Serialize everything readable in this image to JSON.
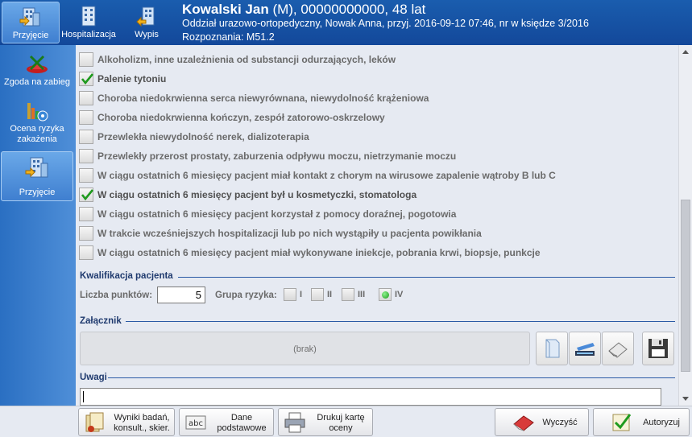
{
  "header": {
    "nav": [
      {
        "label": "Przyjęcie",
        "icon": "building-icon",
        "active": true
      },
      {
        "label": "Hospitalizacja",
        "icon": "building-icon",
        "active": false
      },
      {
        "label": "Wypis",
        "icon": "building-exit-icon",
        "active": false
      }
    ],
    "patient_name": "Kowalski Jan",
    "patient_rest": " (M), 00000000000, 48 lat",
    "line2": "Oddział urazowo-ortopedyczny, Nowak Anna, przyj. 2016-09-12 07:46, nr w księdze 3/2016",
    "line3": "Rozpoznania: M51.2"
  },
  "sidebar": {
    "items": [
      {
        "label": "Zgoda na zabieg",
        "icon": "consent-icon"
      },
      {
        "label": "Ocena ryzyka zakażenia",
        "icon": "risk-chart-icon"
      },
      {
        "label": "Przyjęcie",
        "icon": "building-icon",
        "active": true
      }
    ]
  },
  "checklist": [
    {
      "label": "Alkoholizm, inne uzależnienia od substancji odurzających, leków",
      "checked": false
    },
    {
      "label": "Palenie tytoniu",
      "checked": true
    },
    {
      "label": "Choroba niedokrwienna serca niewyrównana, niewydolność krążeniowa",
      "checked": false
    },
    {
      "label": "Choroba niedokrwienna kończyn, zespół zatorowo-oskrzelowy",
      "checked": false
    },
    {
      "label": "Przewlekła niewydolność nerek, dializoterapia",
      "checked": false
    },
    {
      "label": "Przewlekły przerost prostaty, zaburzenia odpływu moczu, nietrzymanie moczu",
      "checked": false
    },
    {
      "label": "W ciągu ostatnich 6 miesięcy pacjent miał kontakt z chorym na wirusowe zapalenie wątroby B lub C",
      "checked": false
    },
    {
      "label": "W ciągu ostatnich 6 miesięcy pacjent był u kosmetyczki, stomatologa",
      "checked": true
    },
    {
      "label": "W ciągu ostatnich 6 miesięcy pacjent korzystał z pomocy doraźnej, pogotowia",
      "checked": false
    },
    {
      "label": "W trakcie wcześniejszych hospitalizacji lub po nich wystąpiły u pacjenta powikłania",
      "checked": false
    },
    {
      "label": "W ciągu ostatnich 6 miesięcy pacjent miał wykonywane iniekcje, pobrania krwi, biopsje, punkcje",
      "checked": false
    }
  ],
  "qualification": {
    "title": "Kwalifikacja pacjenta",
    "points_label": "Liczba punktów:",
    "points_value": "5",
    "group_label": "Grupa ryzyka:",
    "groups": [
      "I",
      "II",
      "III",
      "IV"
    ],
    "selected_group": "IV"
  },
  "attachment": {
    "title": "Załącznik",
    "empty_text": "(brak)",
    "buttons": [
      "open-file-icon",
      "scanner-icon",
      "eraser-icon",
      "floppy-disk-icon"
    ]
  },
  "remarks": {
    "title": "Uwagi",
    "value": ""
  },
  "bottom": {
    "buttons": [
      {
        "line1": "Wyniki badań,",
        "line2": "konsult., skier.",
        "icon": "documents-icon"
      },
      {
        "line1": "Dane",
        "line2": "podstawowe",
        "icon": "abc-icon"
      },
      {
        "line1": "Drukuj kartę",
        "line2": "oceny",
        "icon": "printer-icon"
      },
      {
        "line1": "Wyczyść",
        "icon": "eraser-icon"
      },
      {
        "line1": "Autoryzuj",
        "icon": "sign-check-icon"
      }
    ]
  },
  "colors": {
    "header_bg": "#1a5dae",
    "sidebar_bg": "#2a6fc2",
    "panel_bg": "#e6eaf2",
    "check_green": "#1e9a1e",
    "section_line": "#2a5aa5"
  }
}
